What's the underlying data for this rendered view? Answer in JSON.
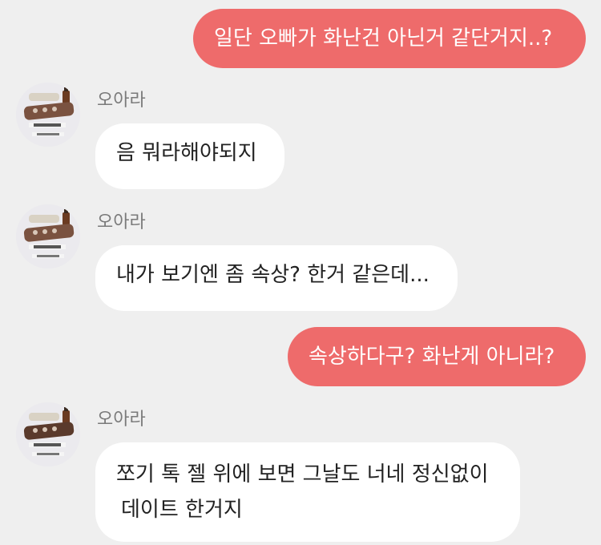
{
  "messages": [
    {
      "direction": "out",
      "text": "일단 오빠가 화난건 아닌거 같단거지..?"
    },
    {
      "direction": "in",
      "sender": "오아라",
      "text": "음 뭐라해야되지"
    },
    {
      "direction": "in",
      "sender": "오아라",
      "text": "내가 보기엔 좀 속상? 한거 같은데..."
    },
    {
      "direction": "out",
      "text": "속상하다구? 화난게 아니라?"
    },
    {
      "direction": "in",
      "sender": "오아라",
      "lines": [
        "쪼기 톡 젤 위에 보면 그날도 너네 정신없이",
        "데이트 한거지"
      ]
    }
  ],
  "colors": {
    "background": "#efefef",
    "outgoing_bubble": "#ee6b6b",
    "outgoing_text": "#ffffff",
    "incoming_bubble": "#ffffff",
    "incoming_text": "#222222",
    "sender_name": "#7a7a7a"
  },
  "icons": {
    "avatar": "profile-photo-avatar"
  }
}
